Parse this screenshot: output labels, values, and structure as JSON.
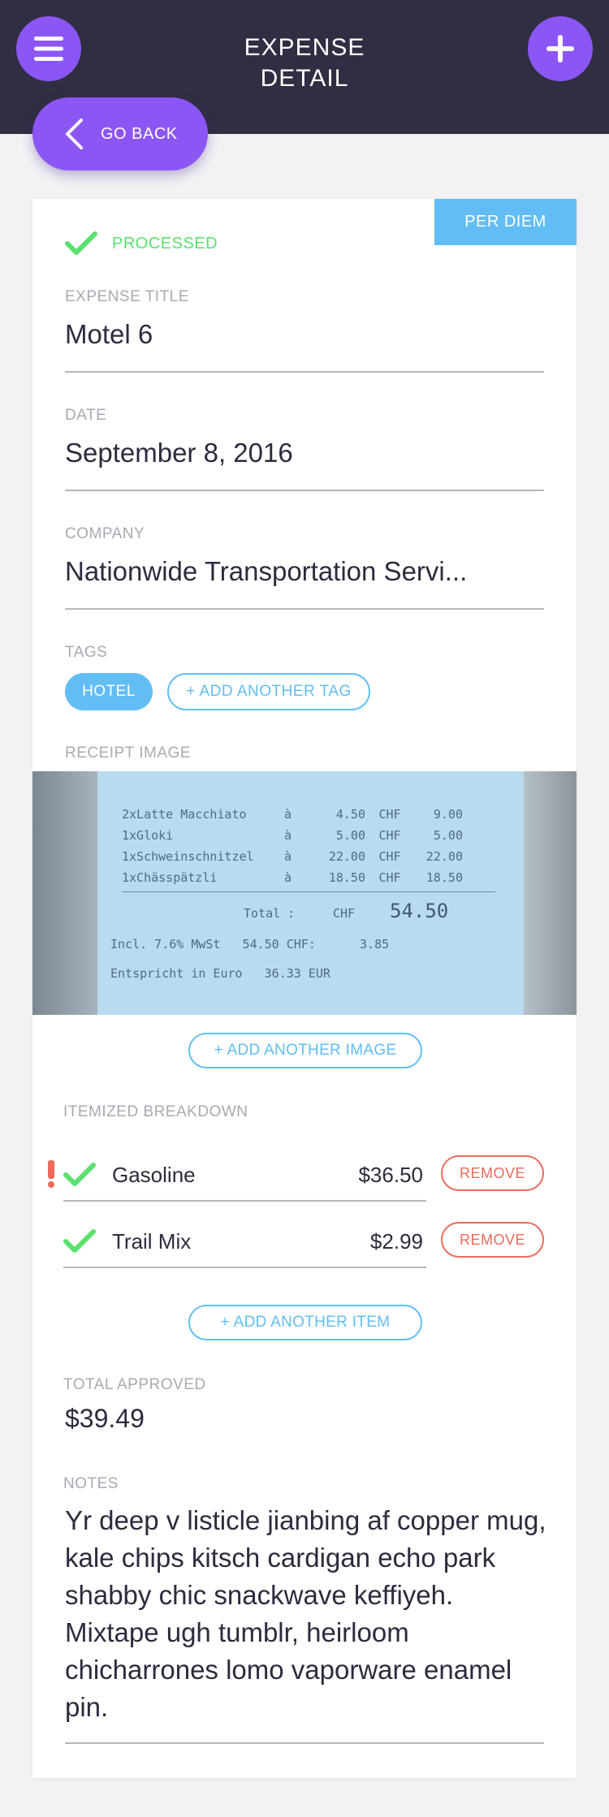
{
  "header": {
    "title_line1": "EXPENSE",
    "title_line2": "DETAIL",
    "go_back_label": "GO BACK"
  },
  "colors": {
    "header_bg": "#302e42",
    "accent_purple": "#8c56f5",
    "accent_blue": "#62bdf5",
    "success_green": "#5ae06e",
    "danger_red": "#ee6a5a"
  },
  "expense": {
    "badge": "PER DIEM",
    "status": "PROCESSED",
    "title_label": "EXPENSE TITLE",
    "title_value": "Motel 6",
    "date_label": "DATE",
    "date_value": "September 8, 2016",
    "company_label": "COMPANY",
    "company_value": "Nationwide Transportation Servi...",
    "tags_label": "TAGS",
    "tags": [
      "HOTEL"
    ],
    "add_tag_label": "+ ADD ANOTHER TAG",
    "receipt_label": "RECEIPT IMAGE",
    "add_image_label": "+ ADD ANOTHER IMAGE",
    "itemized_label": "ITEMIZED BREAKDOWN",
    "items": [
      {
        "name": "Gasoline",
        "amount": "$36.50",
        "remove_label": "REMOVE",
        "flagged": true,
        "checked": true
      },
      {
        "name": "Trail Mix",
        "amount": "$2.99",
        "remove_label": "REMOVE",
        "flagged": false,
        "checked": true
      }
    ],
    "add_item_label": "+ ADD ANOTHER ITEM",
    "total_label": "TOTAL APPROVED",
    "total_value": "$39.49",
    "notes_label": "NOTES",
    "notes_value": "Yr deep v listicle jianbing af copper mug, kale chips kitsch cardigan echo park shabby chic snackwave keffiyeh. Mixtape ugh tumblr, heirloom chicharrones lomo vaporware enamel pin."
  },
  "receipt": {
    "lines": [
      {
        "item": "2xLatte Macchiato",
        "qty": "à",
        "price": "4.50",
        "cur": "CHF",
        "total": "9.00"
      },
      {
        "item": "1xGloki",
        "qty": "à",
        "price": "5.00",
        "cur": "CHF",
        "total": "5.00"
      },
      {
        "item": "1xSchweinschnitzel",
        "qty": "à",
        "price": "22.00",
        "cur": "CHF",
        "total": "22.00"
      },
      {
        "item": "1xChässpätzli",
        "qty": "à",
        "price": "18.50",
        "cur": "CHF",
        "total": "18.50"
      }
    ],
    "total_label": "Total :",
    "total_cur": "CHF",
    "total_value": "54.50",
    "tax_line": "Incl. 7.6% MwSt   54.50 CHF:      3.85",
    "bottom_line": "Entspricht in Euro   36.33 EUR"
  }
}
